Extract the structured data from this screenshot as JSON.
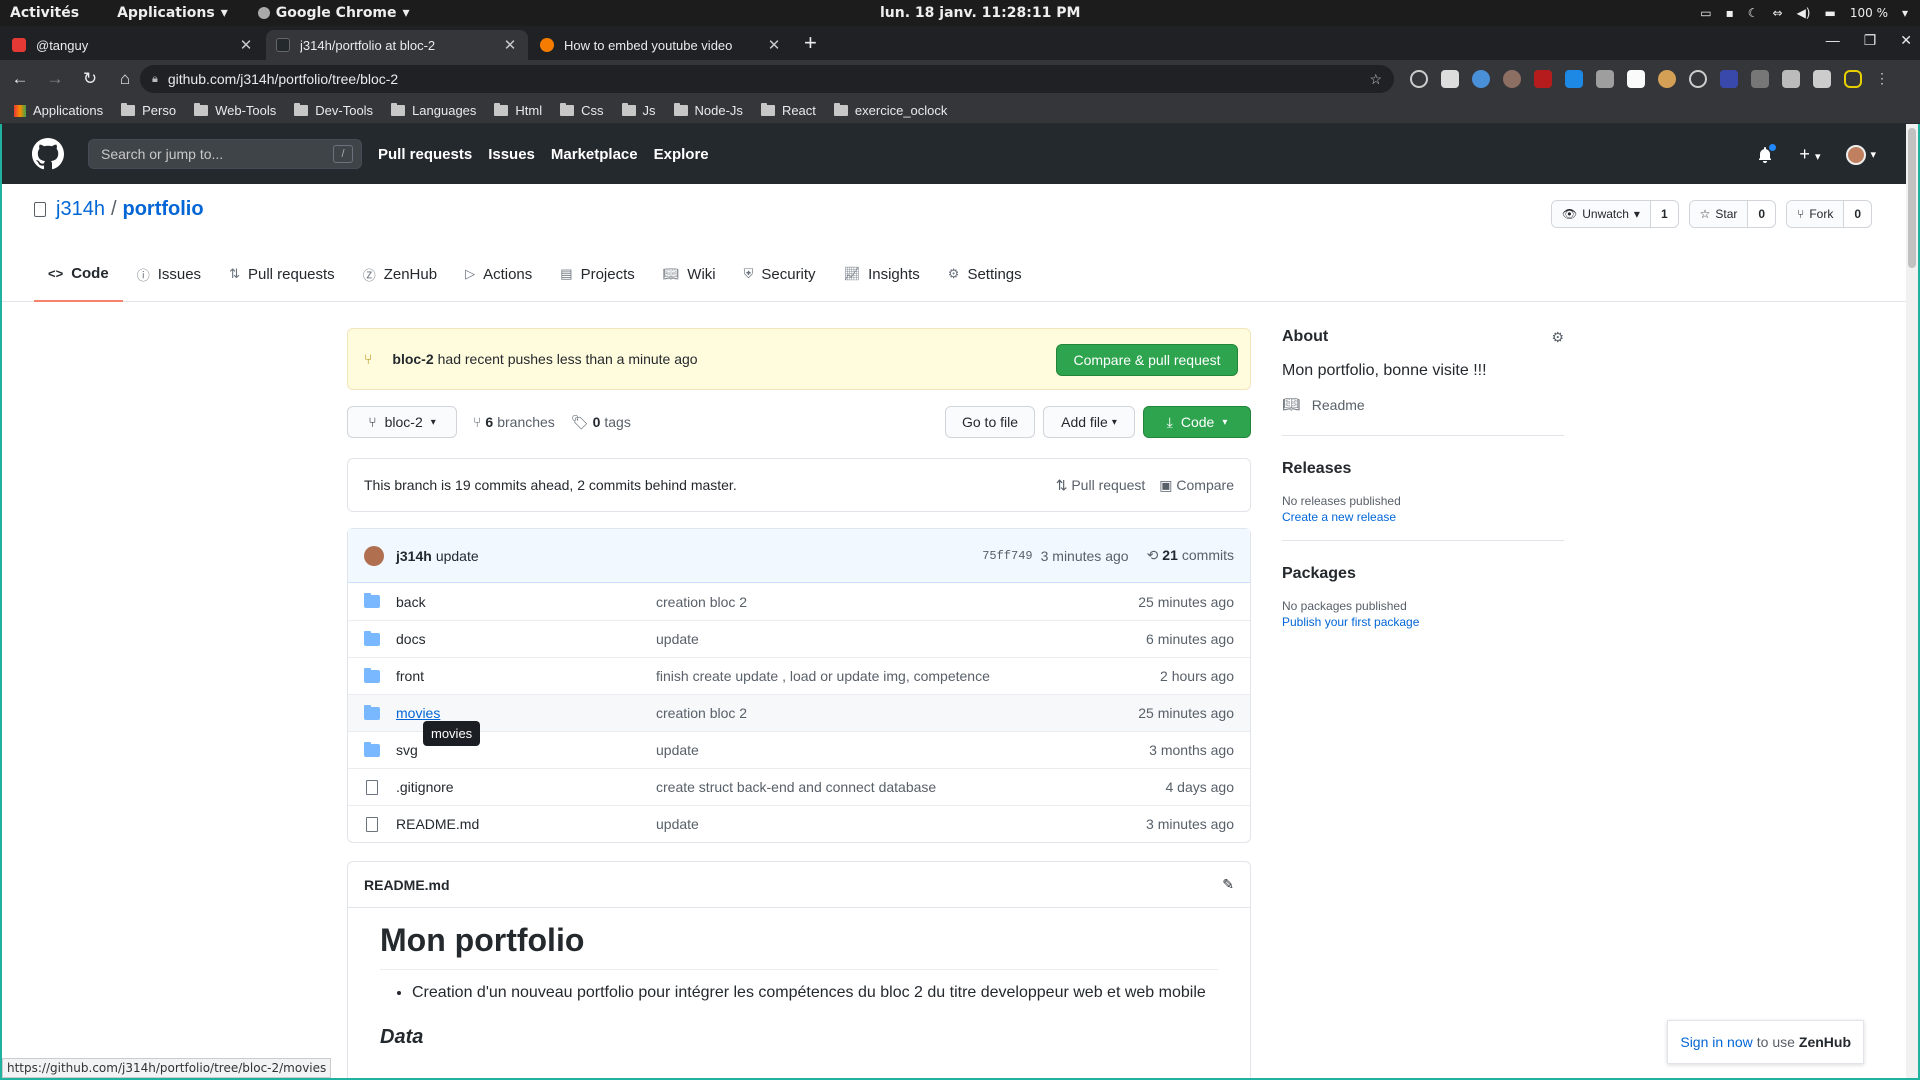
{
  "desktop": {
    "activities": "Activités",
    "applications": "Applications",
    "app_name": "Google Chrome",
    "clock": "lun. 18 janv.  11:28:11 PM",
    "battery": "100 %"
  },
  "browser": {
    "tabs": [
      {
        "title": "@tanguy",
        "color": "#e53935"
      },
      {
        "title": "j314h/portfolio at bloc-2",
        "color": "#24292e"
      },
      {
        "title": "How to embed youtube video",
        "color": "#f57c00"
      }
    ],
    "url": "github.com/j314h/portfolio/tree/bloc-2",
    "bookmarks": [
      "Applications",
      "Perso",
      "Web-Tools",
      "Dev-Tools",
      "Languages",
      "Html",
      "Css",
      "Js",
      "Node-Js",
      "React",
      "exercice_oclock"
    ],
    "status_url": "https://github.com/j314h/portfolio/tree/bloc-2/movies"
  },
  "github": {
    "search_placeholder": "Search or jump to...",
    "search_shortcut": "/",
    "nav": [
      "Pull requests",
      "Issues",
      "Marketplace",
      "Explore"
    ],
    "plus": "+"
  },
  "repo": {
    "owner": "j314h",
    "sep": "/",
    "name": "portfolio",
    "watch_label": "Unwatch",
    "watch_count": "1",
    "star_label": "Star",
    "star_count": "0",
    "fork_label": "Fork",
    "fork_count": "0",
    "tabs": [
      "Code",
      "Issues",
      "Pull requests",
      "ZenHub",
      "Actions",
      "Projects",
      "Wiki",
      "Security",
      "Insights",
      "Settings"
    ]
  },
  "flash": {
    "branch": "bloc-2",
    "text": "had recent pushes less than a minute ago",
    "button": "Compare & pull request"
  },
  "toolbar": {
    "branch": "bloc-2",
    "branches_count": "6",
    "branches_label": "branches",
    "tags_count": "0",
    "tags_label": "tags",
    "goto_file": "Go to file",
    "add_file": "Add file",
    "code": "Code"
  },
  "ahead": {
    "text": "This branch is 19 commits ahead, 2 commits behind master.",
    "pull_request": "Pull request",
    "compare": "Compare"
  },
  "commit": {
    "author": "j314h",
    "message": "update",
    "sha": "75ff749",
    "time": "3 minutes ago",
    "count": "21",
    "count_label": "commits"
  },
  "files": [
    {
      "name": "back",
      "type": "dir",
      "msg": "creation bloc 2",
      "age": "25 minutes ago"
    },
    {
      "name": "docs",
      "type": "dir",
      "msg": "update",
      "age": "6 minutes ago"
    },
    {
      "name": "front",
      "type": "dir",
      "msg": "finish create update , load or update img, competence",
      "age": "2 hours ago"
    },
    {
      "name": "movies",
      "type": "dir",
      "msg": "creation bloc 2",
      "age": "25 minutes ago"
    },
    {
      "name": "svg",
      "type": "dir",
      "msg": "update",
      "age": "3 months ago"
    },
    {
      "name": ".gitignore",
      "type": "file",
      "msg": "create struct back-end and connect database",
      "age": "4 days ago"
    },
    {
      "name": "README.md",
      "type": "file",
      "msg": "update",
      "age": "3 minutes ago"
    }
  ],
  "tooltip": "movies",
  "readme": {
    "filename": "README.md",
    "h1": "Mon portfolio",
    "bullet": "Creation d'un nouveau portfolio pour intégrer les compétences du bloc 2 du titre developpeur web et web mobile",
    "h3": "Data"
  },
  "about": {
    "title": "About",
    "description": "Mon portfolio, bonne visite !!!",
    "readme": "Readme",
    "releases_title": "Releases",
    "releases_none": "No releases published",
    "releases_link": "Create a new release",
    "packages_title": "Packages",
    "packages_none": "No packages published",
    "packages_link": "Publish your first package"
  },
  "zenhub": {
    "link": "Sign in now",
    "text": "to use",
    "brand": "ZenHub"
  }
}
